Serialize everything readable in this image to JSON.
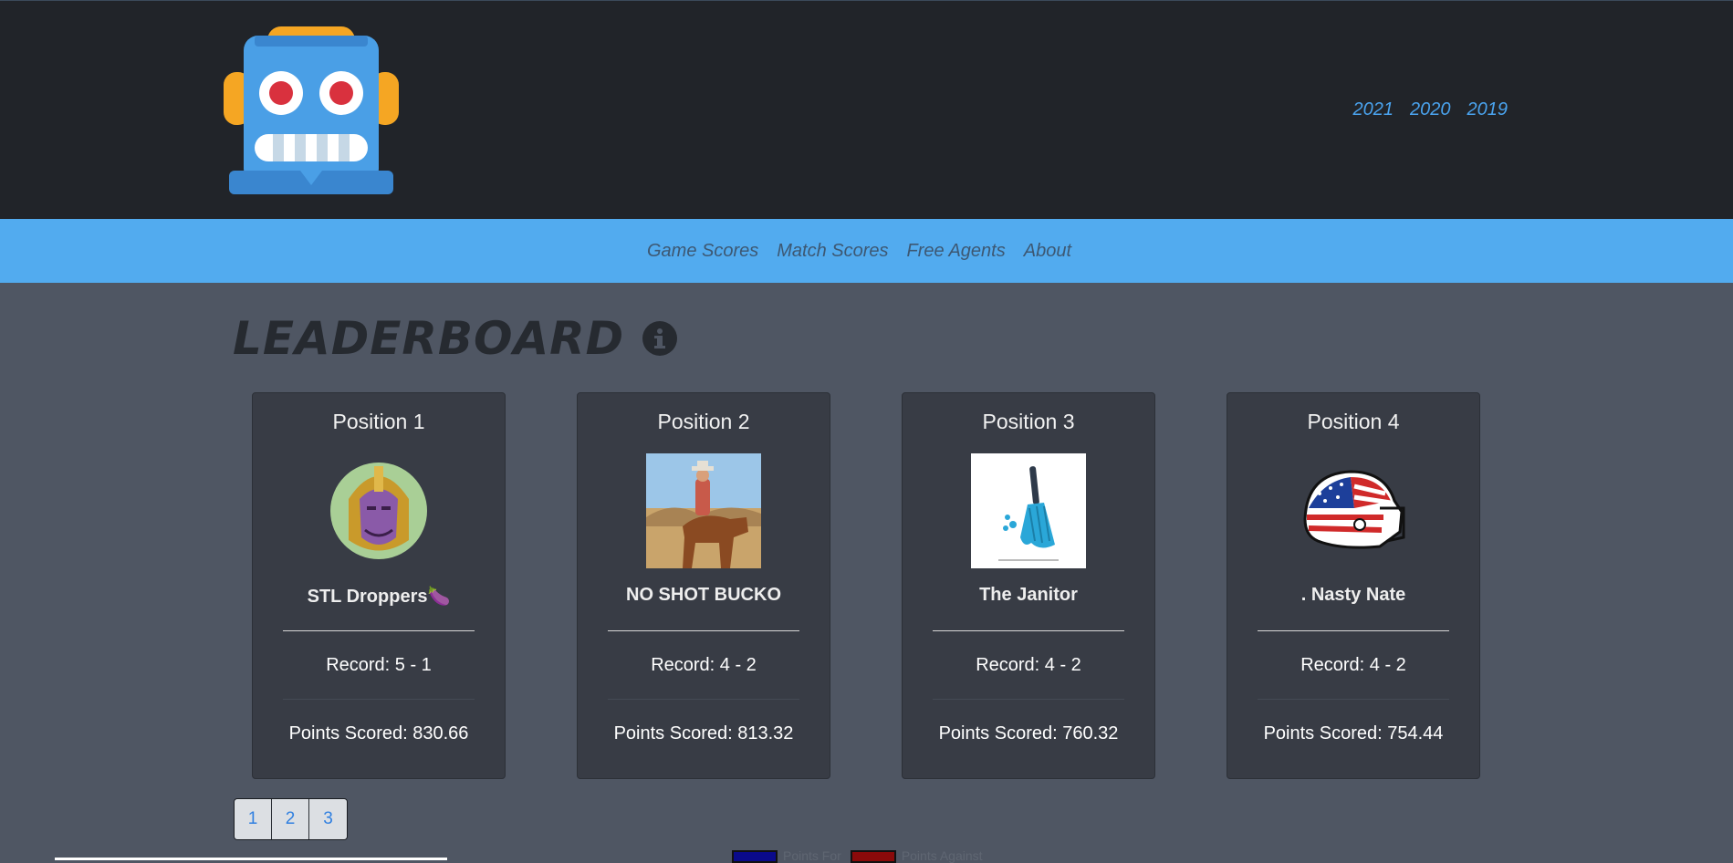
{
  "header": {
    "logo_icon": "robot-face-icon",
    "years": [
      "2021",
      "2020",
      "2019"
    ]
  },
  "nav": {
    "items": [
      "Game Scores",
      "Match Scores",
      "Free Agents",
      "About"
    ]
  },
  "main": {
    "title": "Leaderboard",
    "info_icon": "info-circle-icon"
  },
  "cards": [
    {
      "position": "Position 1",
      "team": "STL Droppers🍆",
      "record": "Record: 5 - 1",
      "points": "Points Scored: 830.66",
      "avatar": "thanos-avatar"
    },
    {
      "position": "Position 2",
      "team": "NO SHOT BUCKO",
      "record": "Record: 4 - 2",
      "points": "Points Scored: 813.32",
      "avatar": "cowboy-on-horse-photo"
    },
    {
      "position": "Position 3",
      "team": "The Janitor",
      "record": "Record: 4 - 2",
      "points": "Points Scored: 760.32",
      "avatar": "mop-icon"
    },
    {
      "position": "Position 4",
      "team": ". Nasty Nate",
      "record": "Record: 4 - 2",
      "points": "Points Scored: 754.44",
      "avatar": "american-flag-helmet-icon"
    }
  ],
  "pagination": {
    "pages": [
      "1",
      "2",
      "3"
    ]
  },
  "legend": {
    "items": [
      {
        "label": "Points For",
        "color": "#0a0a8a"
      },
      {
        "label": "Points Against",
        "color": "#8a0a0a"
      }
    ]
  },
  "colors": {
    "header_bg": "#212429",
    "nav_bg": "#52abef",
    "page_bg": "#4f5663",
    "card_bg": "#383c45",
    "link": "#4aa3ee"
  }
}
